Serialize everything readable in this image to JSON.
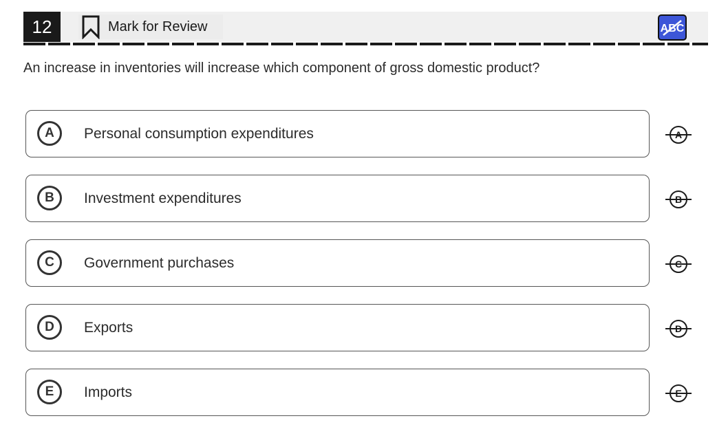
{
  "header": {
    "question_number": "12",
    "mark_for_review_label": "Mark for Review",
    "eliminator_tool_label": "ABC",
    "accent_color": "#3d56d8"
  },
  "question": {
    "text": "An increase in inventories will increase which component of gross domestic product?"
  },
  "choices": [
    {
      "letter": "A",
      "text": "Personal consumption expenditures"
    },
    {
      "letter": "B",
      "text": "Investment expenditures"
    },
    {
      "letter": "C",
      "text": "Government purchases"
    },
    {
      "letter": "D",
      "text": "Exports"
    },
    {
      "letter": "E",
      "text": "Imports"
    }
  ]
}
